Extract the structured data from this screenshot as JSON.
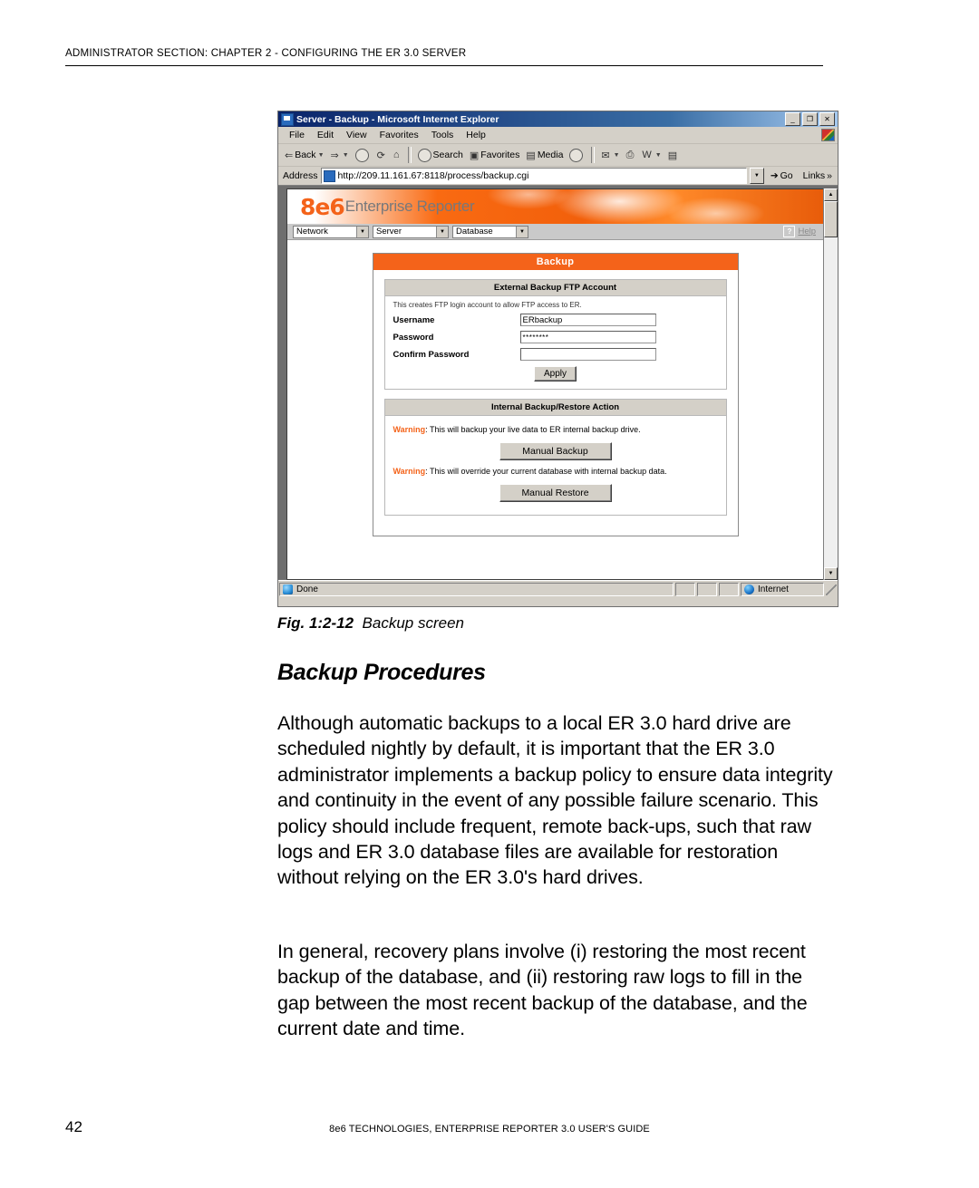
{
  "page": {
    "running_head": "ADMINISTRATOR SECTION: CHAPTER 2 - CONFIGURING THE ER 3.0 SERVER",
    "page_number": "42",
    "footer": "8e6 TECHNOLOGIES, ENTERPRISE REPORTER 3.0 USER'S GUIDE"
  },
  "figure": {
    "caption_prefix": "Fig. 1:2-12",
    "caption_text": "Backup screen"
  },
  "browser": {
    "title": "Server - Backup - Microsoft Internet Explorer",
    "window_buttons": {
      "minimize": "_",
      "maximize": "❐",
      "close": "✕"
    },
    "menu": [
      "File",
      "Edit",
      "View",
      "Favorites",
      "Tools",
      "Help"
    ],
    "toolbar": [
      {
        "label": "Back",
        "icon": "back-arrow-icon",
        "has_caret": true
      },
      {
        "label": "",
        "icon": "forward-arrow-icon",
        "has_caret": true
      },
      {
        "label": "",
        "icon": "stop-icon",
        "has_caret": false
      },
      {
        "label": "",
        "icon": "refresh-icon",
        "has_caret": false
      },
      {
        "label": "",
        "icon": "home-icon",
        "has_caret": false
      },
      {
        "label": "Search",
        "icon": "search-icon",
        "has_caret": false
      },
      {
        "label": "Favorites",
        "icon": "favorites-icon",
        "has_caret": false
      },
      {
        "label": "Media",
        "icon": "media-icon",
        "has_caret": false
      },
      {
        "label": "",
        "icon": "history-icon",
        "has_caret": false
      },
      {
        "label": "",
        "icon": "mail-icon",
        "has_caret": true
      },
      {
        "label": "",
        "icon": "print-icon",
        "has_caret": false
      },
      {
        "label": "",
        "icon": "edit-word-icon",
        "has_caret": true
      },
      {
        "label": "",
        "icon": "discuss-icon",
        "has_caret": false
      }
    ],
    "address": {
      "label": "Address",
      "url": "http://209.11.161.67:8118/process/backup.cgi",
      "go_label": "Go",
      "links_label": "Links"
    },
    "status": {
      "message": "Done",
      "zone": "Internet"
    }
  },
  "app": {
    "logo_mark": "8e6",
    "logo_text": "Enterprise Reporter",
    "nav": [
      {
        "label": "Network"
      },
      {
        "label": "Server"
      },
      {
        "label": "Database"
      }
    ],
    "help_label": "Help",
    "help_icon_glyph": "?",
    "panel_title": "Backup",
    "ftp_section": {
      "heading": "External Backup FTP Account",
      "note": "This creates FTP login account to allow FTP access to ER.",
      "fields": [
        {
          "label": "Username",
          "value": "ERbackup",
          "masked": false
        },
        {
          "label": "Password",
          "value": "********",
          "masked": true
        },
        {
          "label": "Confirm Password",
          "value": "",
          "masked": false
        }
      ],
      "apply_label": "Apply"
    },
    "internal_section": {
      "heading": "Internal Backup/Restore Action",
      "warning_label": "Warning",
      "backup_warning": ": This will backup your live data to ER internal backup drive.",
      "backup_button": "Manual Backup",
      "restore_warning": ": This will override your current database with internal backup data.",
      "restore_button": "Manual Restore"
    }
  },
  "content": {
    "section_heading": "Backup Procedures",
    "paragraph_1": "Although automatic backups to a local ER 3.0 hard drive are scheduled nightly by default, it is important that the ER 3.0 administrator implements a backup policy to ensure data integrity and continuity in the event of any possible failure scenario. This policy should include frequent, remote back-ups, such that raw logs and ER 3.0 database files are available for restoration without relying on the ER 3.0's hard drives.",
    "paragraph_2": "In general, recovery plans involve (i) restoring the most recent backup of the database, and (ii) restoring raw logs to fill in the gap between the most recent backup of the database, and the current date and time."
  },
  "colors": {
    "brand_orange": "#f4631a",
    "titlebar_blue": "#0a246a",
    "chrome_gray": "#d4d0c8"
  }
}
